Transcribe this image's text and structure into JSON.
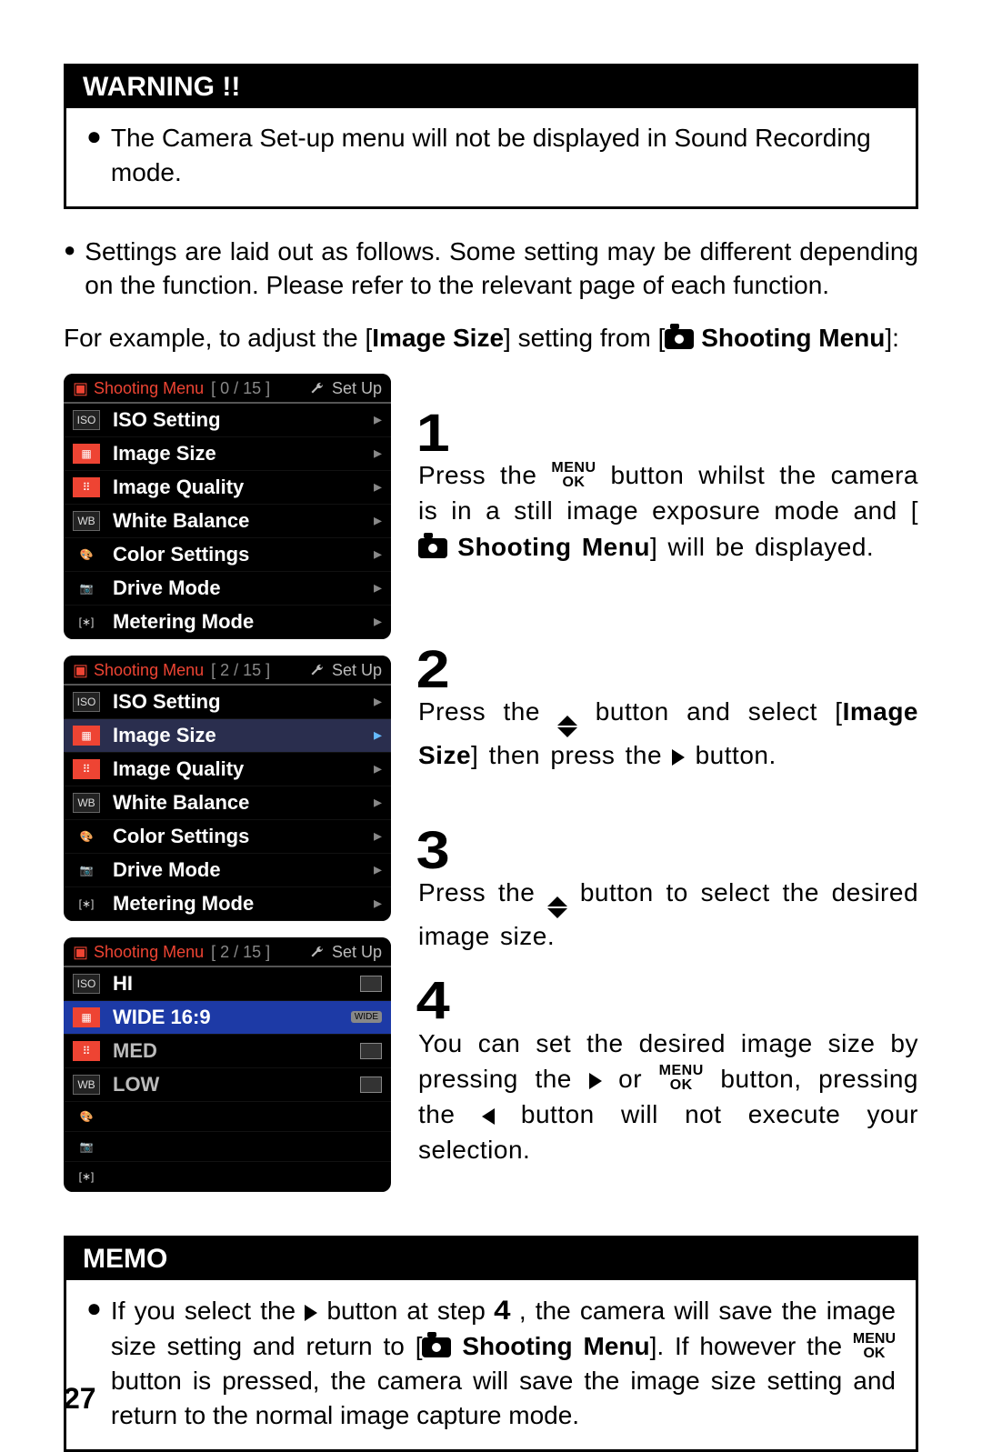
{
  "warning": {
    "title": "WARNING !!",
    "item": "The Camera Set-up menu will not be displayed in Sound Recording mode."
  },
  "intro": {
    "bullet": "Settings are laid out as follows. Some setting may be different depending on the function. Please refer to the relevant page of each function.",
    "lead_pre": "For example, to adjust the [",
    "lead_setting": "Image Size",
    "lead_mid": "] setting from [",
    "lead_menu": "Shooting Menu",
    "lead_post": "]:"
  },
  "panels": [
    {
      "title": "Shooting Menu",
      "count": "[ 0 / 15 ]",
      "setup": "Set Up",
      "items": [
        {
          "label": "ISO Setting",
          "icon": "ISO",
          "hl": false
        },
        {
          "label": "Image Size",
          "icon": "grid",
          "hl": false
        },
        {
          "label": "Image Quality",
          "icon": "dots",
          "hl": false
        },
        {
          "label": "White Balance",
          "icon": "WB",
          "hl": false
        },
        {
          "label": "Color Settings",
          "icon": "pal",
          "hl": false
        },
        {
          "label": "Drive Mode",
          "icon": "cam2",
          "hl": false
        },
        {
          "label": "Metering Mode",
          "icon": "mt",
          "hl": false
        }
      ]
    },
    {
      "title": "Shooting Menu",
      "count": "[ 2 / 15 ]",
      "setup": "Set Up",
      "items": [
        {
          "label": "ISO Setting",
          "icon": "ISO",
          "hl": false
        },
        {
          "label": "Image Size",
          "icon": "grid",
          "hl": true
        },
        {
          "label": "Image Quality",
          "icon": "dots",
          "hl": false
        },
        {
          "label": "White Balance",
          "icon": "WB",
          "hl": false
        },
        {
          "label": "Color Settings",
          "icon": "pal",
          "hl": false
        },
        {
          "label": "Drive Mode",
          "icon": "cam2",
          "hl": false
        },
        {
          "label": "Metering Mode",
          "icon": "mt",
          "hl": false
        }
      ]
    },
    {
      "title": "Shooting Menu",
      "count": "[ 2 / 15 ]",
      "setup": "Set Up",
      "options": [
        {
          "label": "HI",
          "tag": "icon"
        },
        {
          "label": "WIDE 16:9",
          "tag": "wide",
          "hl": true
        },
        {
          "label": "MED",
          "tag": "icon"
        },
        {
          "label": "LOW",
          "tag": "icon"
        }
      ]
    }
  ],
  "steps": {
    "s1": {
      "num": "1",
      "t1": "Press the ",
      "t2": " button whilst the camera is in a still image exposure mode and [",
      "menu": "Shooting Menu",
      "t3": "] will be displayed."
    },
    "s2": {
      "num": "2",
      "t1": "Press the ",
      "t2": " button and select [",
      "setting": "Image Size",
      "t3": "] then press the ",
      "t4": " button."
    },
    "s3": {
      "num": "3",
      "t1": "Press the ",
      "t2": " button to select the desired image size."
    },
    "s4": {
      "num": "4",
      "t1": "You can set the desired image size by pressing the ",
      "t2": " or ",
      "t3": " button, pressing the ",
      "t4": " button will not execute your selection."
    }
  },
  "memo": {
    "title": "MEMO",
    "t1": "If you select the ",
    "t2": " button at step ",
    "stepnum": "4",
    "t3": " , the camera will save the image size setting and return to [",
    "menu": "Shooting Menu",
    "t4": "]. If however the ",
    "t5": " button is pressed, the camera will save the image size setting and return to the normal image capture mode."
  },
  "page_number": "27"
}
